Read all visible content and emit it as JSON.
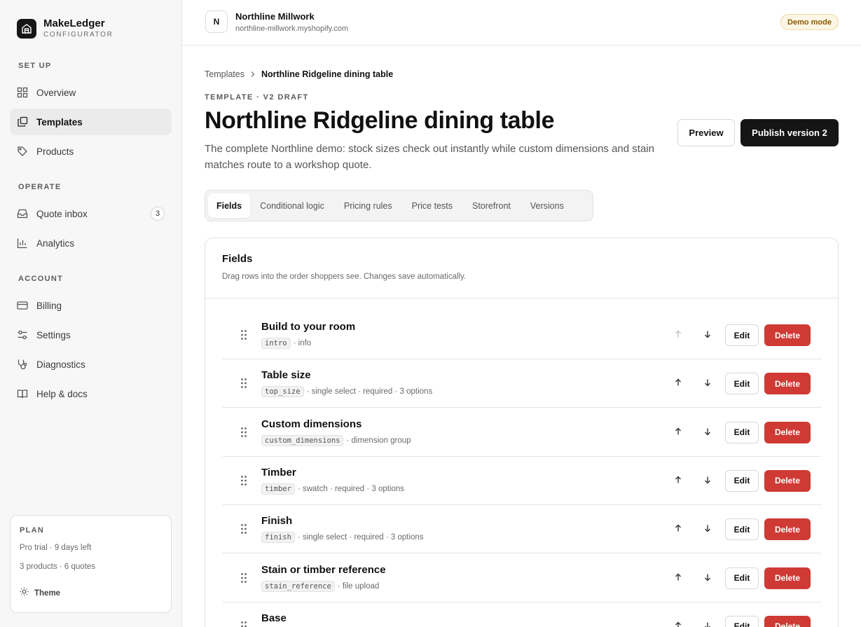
{
  "brand": {
    "name": "MakeLedger",
    "subtitle": "CONFIGURATOR"
  },
  "sidebar": {
    "sections": [
      {
        "label": "SET UP"
      },
      {
        "label": "OPERATE"
      },
      {
        "label": "ACCOUNT"
      }
    ],
    "items": [
      {
        "label": "Overview",
        "icon": "grid-icon"
      },
      {
        "label": "Templates",
        "icon": "layers-icon",
        "active": true
      },
      {
        "label": "Products",
        "icon": "tag-icon"
      },
      {
        "label": "Quote inbox",
        "icon": "inbox-icon",
        "badge": "3"
      },
      {
        "label": "Analytics",
        "icon": "bar-chart-icon"
      },
      {
        "label": "Billing",
        "icon": "credit-card-icon"
      },
      {
        "label": "Settings",
        "icon": "sliders-icon"
      },
      {
        "label": "Diagnostics",
        "icon": "stethoscope-icon"
      },
      {
        "label": "Help & docs",
        "icon": "book-icon"
      }
    ],
    "plan": {
      "title": "PLAN",
      "line1": "Pro trial · 9 days left",
      "line2": "3 products · 6 quotes",
      "theme_label": "Theme"
    }
  },
  "header": {
    "store_initial": "N",
    "store_name": "Northline Millwork",
    "store_url": "northline-millwork.myshopify.com",
    "demo_badge": "Demo mode"
  },
  "breadcrumb": {
    "parent": "Templates",
    "current": "Northline Ridgeline dining table"
  },
  "page": {
    "eyebrow": "TEMPLATE · V2 DRAFT",
    "title": "Northline Ridgeline dining table",
    "description": "The complete Northline demo: stock sizes check out instantly while custom dimensions and stain matches route to a workshop quote.",
    "preview_label": "Preview",
    "publish_label": "Publish version 2"
  },
  "tabs": [
    {
      "label": "Fields",
      "active": true
    },
    {
      "label": "Conditional logic"
    },
    {
      "label": "Pricing rules"
    },
    {
      "label": "Price tests"
    },
    {
      "label": "Storefront"
    },
    {
      "label": "Versions"
    }
  ],
  "fields_card": {
    "title": "Fields",
    "subtitle": "Drag rows into the order shoppers see. Changes save automatically.",
    "edit_label": "Edit",
    "delete_label": "Delete",
    "rows": [
      {
        "title": "Build to your room",
        "key": "intro",
        "meta": "· info",
        "up_disabled": true
      },
      {
        "title": "Table size",
        "key": "top_size",
        "meta": "· single select · required · 3 options"
      },
      {
        "title": "Custom dimensions",
        "key": "custom_dimensions",
        "meta": "· dimension group"
      },
      {
        "title": "Timber",
        "key": "timber",
        "meta": "· swatch · required · 3 options"
      },
      {
        "title": "Finish",
        "key": "finish",
        "meta": "· single select · required · 3 options"
      },
      {
        "title": "Stain or timber reference",
        "key": "stain_reference",
        "meta": "· file upload"
      },
      {
        "title": "Base",
        "key": "",
        "meta": ""
      }
    ]
  },
  "colors": {
    "accent": "#151515",
    "danger": "#cf3a34",
    "demo_badge_bg": "#fdf6e5",
    "demo_badge_text": "#8a5a00"
  }
}
